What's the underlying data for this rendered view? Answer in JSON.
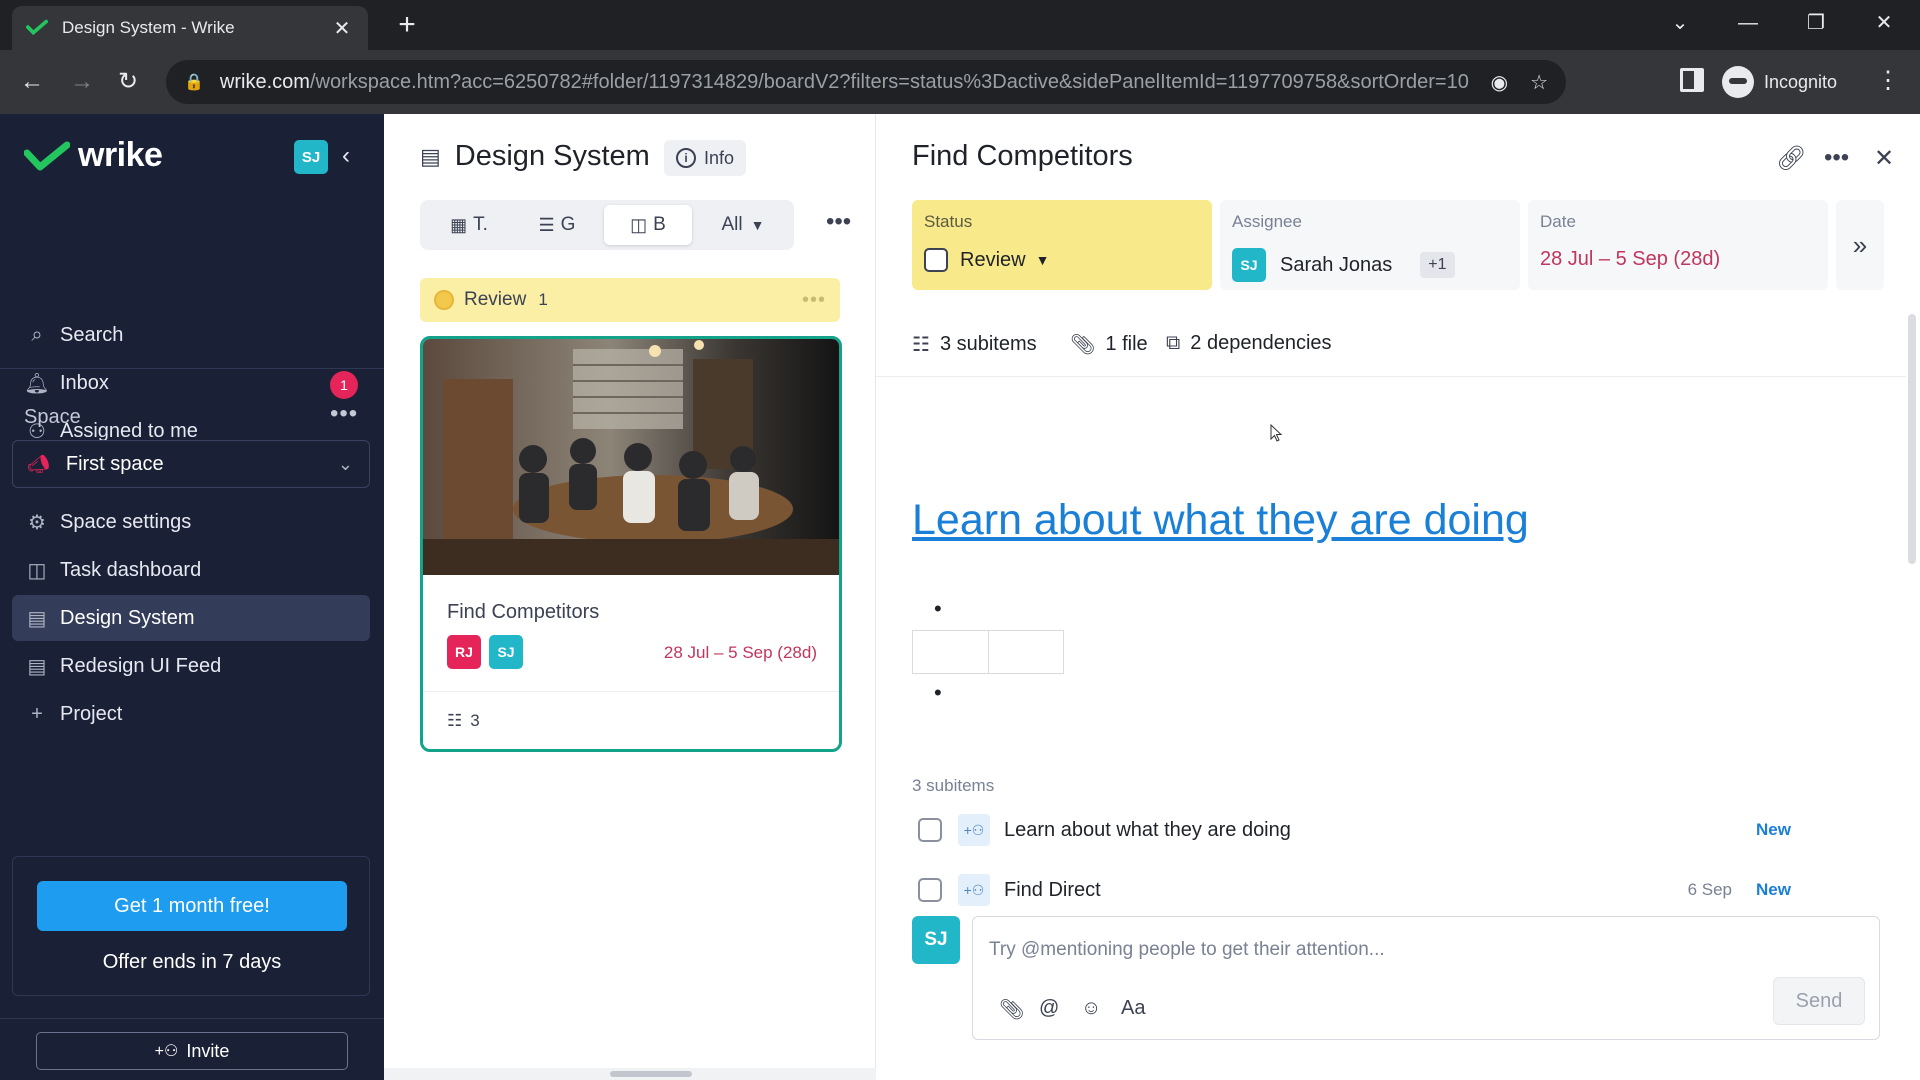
{
  "browser": {
    "tab_title": "Design System - Wrike",
    "tab_close": "✕",
    "new_tab": "+",
    "url_host": "wrike.com",
    "url_path": "/workspace.htm?acc=6250782#folder/1197314829/boardV2?filters=status%3Dactive&sidePanelItemId=1197709758&sortOrder=10...",
    "incognito_label": "Incognito"
  },
  "sidebar": {
    "brand": "wrike",
    "user_initials": "SJ",
    "nav": [
      {
        "label": "Search",
        "icon": "search-icon"
      },
      {
        "label": "Inbox",
        "icon": "bell-icon",
        "badge": "1"
      },
      {
        "label": "Assigned to me",
        "icon": "person-icon"
      }
    ],
    "space_label": "Space",
    "space_more": "•••",
    "space_name": "First space",
    "items": [
      {
        "label": "Space settings",
        "icon": "gear-icon"
      },
      {
        "label": "Task dashboard",
        "icon": "dashboard-icon"
      },
      {
        "label": "Design System",
        "icon": "project-icon",
        "active": true
      },
      {
        "label": "Redesign UI Feed",
        "icon": "project-icon"
      },
      {
        "label": "Project",
        "icon": "plus-icon"
      }
    ],
    "promo_button": "Get 1 month free!",
    "promo_text": "Offer ends in 7 days",
    "invite": "Invite"
  },
  "board": {
    "title": "Design System",
    "info": "Info",
    "views": [
      {
        "label": "T.",
        "icon": "table-icon"
      },
      {
        "label": "G",
        "icon": "gantt-icon"
      },
      {
        "label": "B",
        "icon": "board-icon",
        "active": true
      }
    ],
    "filter": "All",
    "more": "•••",
    "column": {
      "name": "Review",
      "count": "1",
      "more": "•••"
    },
    "card": {
      "title": "Find Competitors",
      "assignees": [
        {
          "initials": "RJ",
          "color": "#e5245a"
        },
        {
          "initials": "SJ",
          "color": "#22b6c9"
        }
      ],
      "date": "28 Jul – 5 Sep (28d)",
      "subitems": "3"
    }
  },
  "detail": {
    "title": "Find Competitors",
    "status_label": "Status",
    "status_value": "Review",
    "assignee_label": "Assignee",
    "assignee_initials": "SJ",
    "assignee_name": "Sarah Jonas",
    "assignee_extra": "+1",
    "date_label": "Date",
    "date_value": "28 Jul – 5 Sep (28d)",
    "expand": "»",
    "meta": {
      "subitems": "3 subitems",
      "files": "1 file",
      "dependencies": "2 dependencies"
    },
    "description_link": "Learn about what they are doing",
    "bullet": "•",
    "subitems_label": "3 subitems",
    "subitems": [
      {
        "name": "Learn about what they are doing",
        "date": "",
        "status": "New"
      },
      {
        "name": "Find Direct",
        "date": "6 Sep",
        "status": "New"
      }
    ],
    "comment_initials": "SJ",
    "comment_placeholder": "Try @mentioning people to get their attention...",
    "comment_tools": {
      "attach": "📎",
      "mention": "@",
      "emoji": "☺",
      "format": "Aa"
    },
    "send": "Send"
  },
  "colors": {
    "sidebar_bg": "#1a2036",
    "accent_green": "#12a38a",
    "status_yellow": "#f8e98a",
    "link_blue": "#1a7fd6",
    "date_red": "#c0365c"
  }
}
